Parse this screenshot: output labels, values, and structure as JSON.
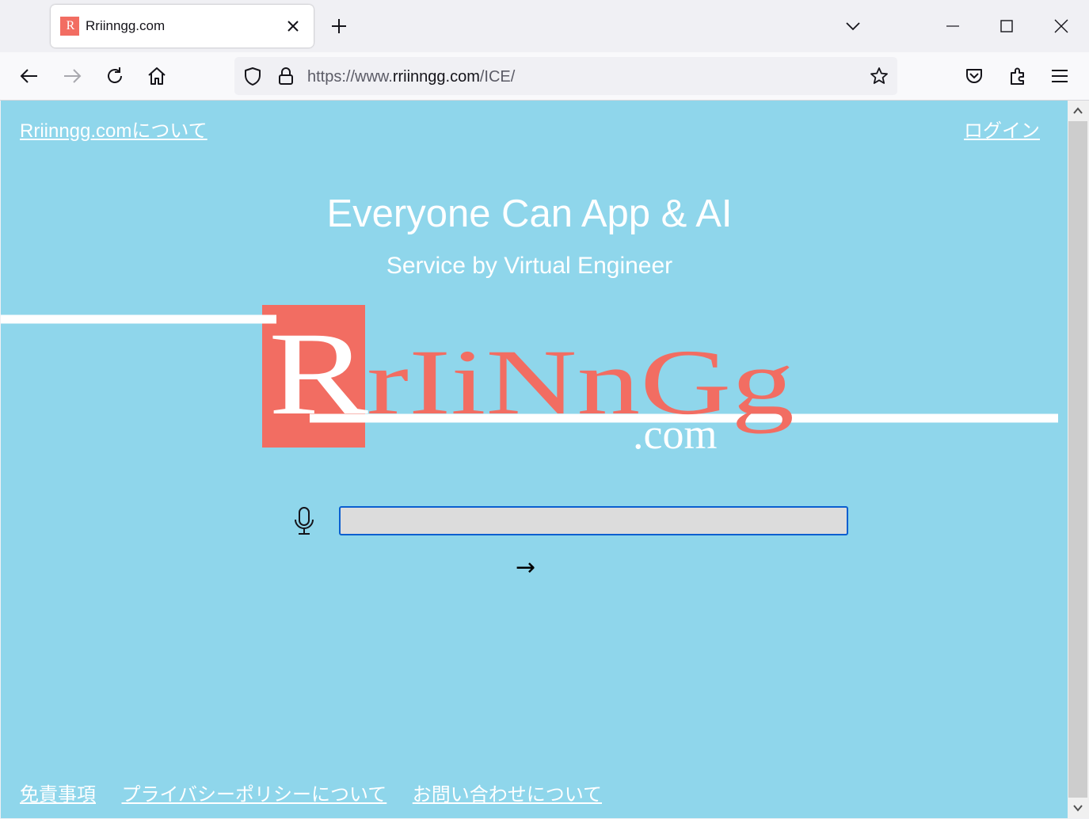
{
  "browser": {
    "tab": {
      "title": "Rriinngg.com",
      "favicon_text": "R"
    },
    "url": {
      "prefix": "https://www.",
      "domain": "rriinngg.com",
      "path": "/ICE/"
    }
  },
  "page": {
    "about_link": "Rriinngg.comについて",
    "login_link": "ログイン",
    "headline": "Everyone Can App & AI",
    "subline": "Service by Virtual Engineer",
    "logo": {
      "letters": "RrIiNnGg",
      "suffix": ".com"
    },
    "search": {
      "value": "",
      "placeholder": ""
    },
    "submit_label": "→",
    "footer": [
      "免責事項",
      "プライバシーポリシーについて",
      "お問い合わせについて"
    ]
  },
  "colors": {
    "background": "#8fd6eb",
    "brand": "#f26d62",
    "focus": "#0a5fd0",
    "text": "#ffffff"
  }
}
